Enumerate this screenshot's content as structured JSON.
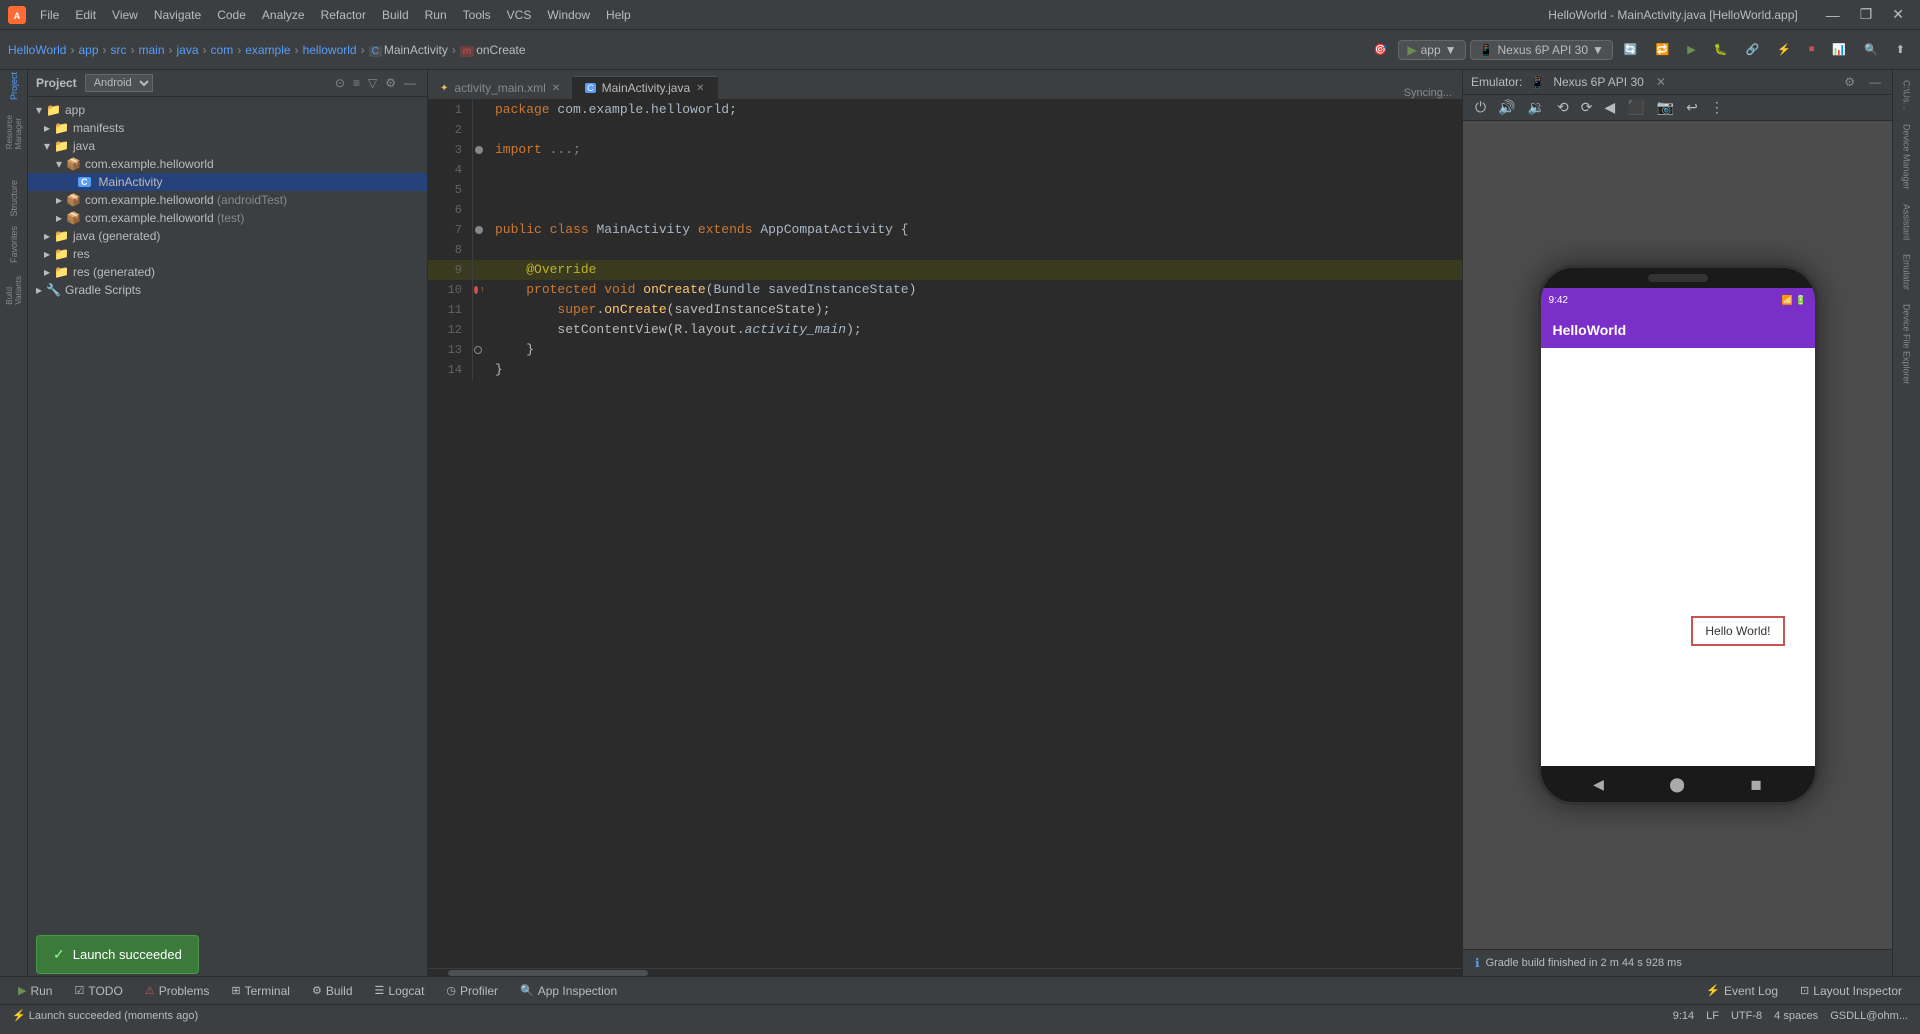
{
  "titleBar": {
    "appName": "HelloWorld",
    "fileName": "MainActivity.java",
    "projectName": "[HelloWorld.app]",
    "title": "HelloWorld - MainActivity.java [HelloWorld.app]",
    "icon": "A",
    "minimize": "—",
    "maximize": "❐",
    "close": "✕"
  },
  "menuBar": {
    "items": [
      "File",
      "Edit",
      "View",
      "Navigate",
      "Code",
      "Analyze",
      "Refactor",
      "Build",
      "Run",
      "Tools",
      "VCS",
      "Window",
      "Help"
    ]
  },
  "toolbar": {
    "breadcrumb": {
      "items": [
        "HelloWorld",
        "app",
        "src",
        "main",
        "java",
        "com",
        "example",
        "helloworld",
        "MainActivity",
        "onCreate"
      ],
      "separators": [
        ">",
        ">",
        ">",
        ">",
        ">",
        ">",
        ">",
        ">",
        ">"
      ]
    },
    "runConfig": "app",
    "device": "Nexus 6P API 30"
  },
  "projectPanel": {
    "title": "Project",
    "viewMode": "Android",
    "tree": [
      {
        "level": 0,
        "label": "app",
        "type": "folder",
        "expanded": true
      },
      {
        "level": 1,
        "label": "manifests",
        "type": "folder",
        "expanded": false
      },
      {
        "level": 1,
        "label": "java",
        "type": "folder",
        "expanded": true
      },
      {
        "level": 2,
        "label": "com.example.helloworld",
        "type": "package",
        "expanded": true
      },
      {
        "level": 3,
        "label": "MainActivity",
        "type": "file-java",
        "selected": true
      },
      {
        "level": 2,
        "label": "com.example.helloworld (androidTest)",
        "type": "package",
        "expanded": false
      },
      {
        "level": 2,
        "label": "com.example.helloworld (test)",
        "type": "package",
        "expanded": false
      },
      {
        "level": 1,
        "label": "java (generated)",
        "type": "folder",
        "expanded": false
      },
      {
        "level": 1,
        "label": "res",
        "type": "folder",
        "expanded": false
      },
      {
        "level": 1,
        "label": "res (generated)",
        "type": "folder",
        "expanded": false
      },
      {
        "level": 0,
        "label": "Gradle Scripts",
        "type": "folder",
        "expanded": false
      }
    ]
  },
  "editor": {
    "tabs": [
      {
        "label": "activity_main.xml",
        "icon": "xml",
        "active": false,
        "closeable": true
      },
      {
        "label": "MainActivity.java",
        "icon": "java",
        "active": true,
        "closeable": true
      }
    ],
    "syncStatus": "Syncing...",
    "lines": [
      {
        "num": 1,
        "content": "package com.example.helloworld;",
        "type": "package"
      },
      {
        "num": 2,
        "content": "",
        "type": "blank"
      },
      {
        "num": 3,
        "content": "import ...;",
        "type": "import"
      },
      {
        "num": 4,
        "content": "",
        "type": "blank"
      },
      {
        "num": 5,
        "content": "",
        "type": "blank"
      },
      {
        "num": 6,
        "content": "",
        "type": "blank"
      },
      {
        "num": 7,
        "content": "public class MainActivity extends AppCompatActivity {",
        "type": "class"
      },
      {
        "num": 8,
        "content": "",
        "type": "blank"
      },
      {
        "num": 9,
        "content": "    @Override",
        "type": "annotation",
        "highlight": true
      },
      {
        "num": 10,
        "content": "    protected void onCreate(Bundle savedInstanceState)",
        "type": "method"
      },
      {
        "num": 11,
        "content": "        super.onCreate(savedInstanceState);",
        "type": "code"
      },
      {
        "num": 12,
        "content": "        setContentView(R.layout.activity_main);",
        "type": "code"
      },
      {
        "num": 13,
        "content": "    }",
        "type": "code"
      },
      {
        "num": 14,
        "content": "}",
        "type": "code"
      }
    ]
  },
  "emulator": {
    "title": "Emulator:",
    "device": "Nexus 6P API 30",
    "phoneStatus": {
      "time": "9:42",
      "appBarTitle": "HelloWorld"
    },
    "helloWorldText": "Hello World!",
    "gradleMessage": "Gradle build finished in 2 m 44 s 928 ms"
  },
  "rightSidebar": {
    "items": [
      "C:\\Us...",
      "Device Manager",
      "Assistant",
      "Emulator",
      "Device File Explorer"
    ]
  },
  "bottomTabs": [
    {
      "icon": "▶",
      "label": "Run"
    },
    {
      "icon": "☑",
      "label": "TODO"
    },
    {
      "icon": "⚠",
      "label": "Problems"
    },
    {
      "icon": "⊞",
      "label": "Terminal"
    },
    {
      "icon": "⚙",
      "label": "Build"
    },
    {
      "icon": "☰",
      "label": "Logcat"
    },
    {
      "icon": "◷",
      "label": "Profiler"
    },
    {
      "icon": "🔍",
      "label": "App Inspection"
    }
  ],
  "statusBar": {
    "launchMessage": "⚡ Launch succeeded (moments ago)",
    "layoutInspector": "Layout Inspector",
    "position": "9:14",
    "lineEnding": "LF",
    "encoding": "UTF-8",
    "indent": "4 spaces",
    "user": "GSDLL@ohm..."
  },
  "toast": {
    "label": "Launch succeeded"
  }
}
